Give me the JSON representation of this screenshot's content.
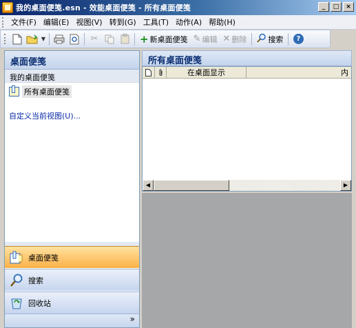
{
  "window": {
    "title": "我的桌面便笺.esn - 效能桌面便笺 - 所有桌面便笺",
    "buttons": {
      "minimize": "_",
      "maximize": "□",
      "close": "×"
    }
  },
  "menu": {
    "items": [
      {
        "label": "文件(F)"
      },
      {
        "label": "编辑(E)"
      },
      {
        "label": "视图(V)"
      },
      {
        "label": "转到(G)"
      },
      {
        "label": "工具(T)"
      },
      {
        "label": "动作(A)"
      },
      {
        "label": "帮助(H)"
      }
    ]
  },
  "toolbar": {
    "new_note": "新桌面便笺",
    "edit": "编辑",
    "delete": "删除",
    "search": "搜索",
    "help": "?",
    "icons": [
      "new-document-icon",
      "open-folder-icon",
      "print-icon",
      "print-preview-icon",
      "cut-icon",
      "copy-icon",
      "paste-icon"
    ]
  },
  "nav": {
    "header": "桌面便笺",
    "group": "我的桌面便笺",
    "folder": "所有桌面便笺",
    "customize": "自定义当前视图(U)...",
    "buttons": [
      {
        "label": "桌面便笺",
        "icon": "notes-icon",
        "active": true
      },
      {
        "label": "搜索",
        "icon": "search-icon",
        "active": false
      },
      {
        "label": "回收站",
        "icon": "recycle-bin-icon",
        "active": false
      }
    ],
    "footer": "»"
  },
  "main": {
    "header": "所有桌面便笺",
    "columns": [
      "",
      "",
      "在桌面显示",
      "内"
    ]
  }
}
